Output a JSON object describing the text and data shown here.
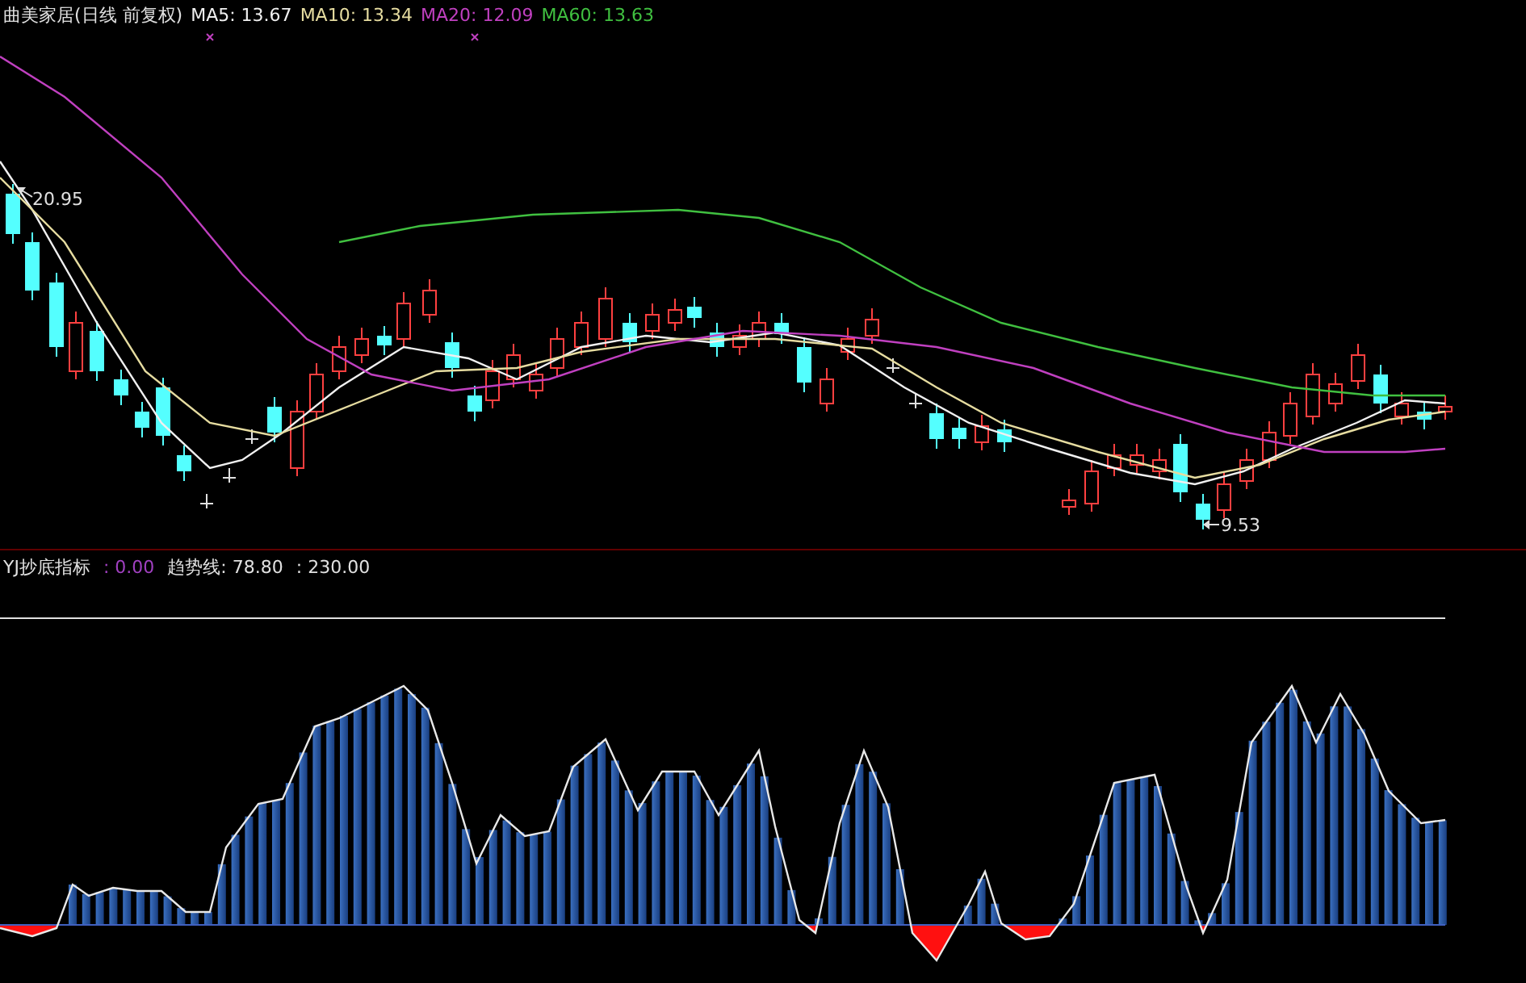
{
  "header": {
    "title": "曲美家居(日线 前复权)",
    "indicators": [
      {
        "label": "MA5: 13.67",
        "color": "#f0f0f0"
      },
      {
        "label": "MA10: 13.34",
        "color": "#e6dca0"
      },
      {
        "label": "MA20: 12.09",
        "color": "#c040c0"
      },
      {
        "label": "MA60: 13.63",
        "color": "#40c040"
      }
    ]
  },
  "price_chart": {
    "high_label": "20.95",
    "low_label": "9.53"
  },
  "indicator_panel": {
    "title": "YJ抄底指标",
    "values": [
      {
        "label": ": 0.00",
        "color": "#a040c0"
      },
      {
        "label": "趋势线: 78.80",
        "color": "#e0e0e0"
      },
      {
        "label": ": 230.00",
        "color": "#e0e0e0"
      }
    ]
  }
}
